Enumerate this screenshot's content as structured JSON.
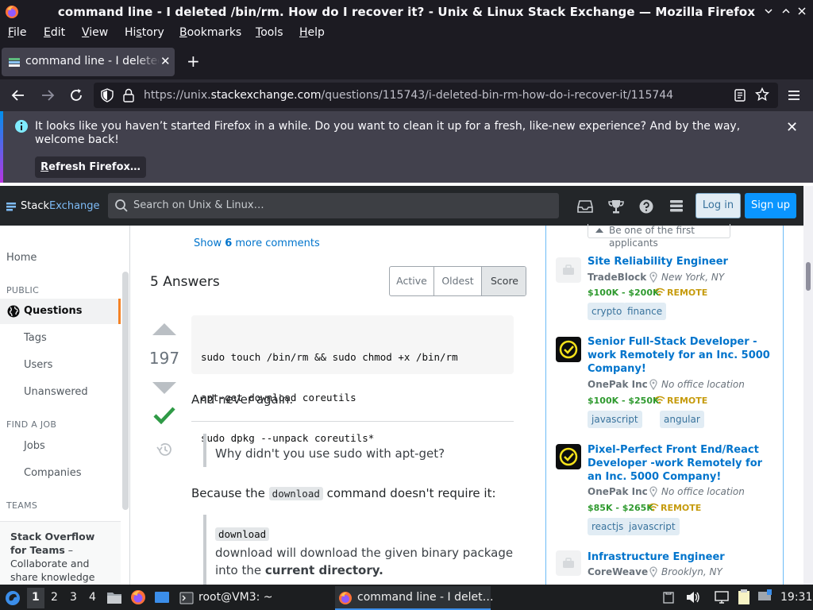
{
  "window": {
    "title": "command line - I deleted /bin/rm. How do I recover it? - Unix & Linux Stack Exchange — Mozilla Firefox"
  },
  "menu": {
    "items": [
      {
        "u": "F",
        "rest": "ile"
      },
      {
        "u": "E",
        "rest": "dit"
      },
      {
        "u": "V",
        "rest": "iew"
      },
      {
        "pre": "Hi",
        "u": "s",
        "rest": "tory"
      },
      {
        "u": "B",
        "rest": "ookmarks"
      },
      {
        "u": "T",
        "rest": "ools"
      },
      {
        "u": "H",
        "rest": "elp"
      }
    ]
  },
  "tab": {
    "label": "command line - I deleted /bin/rm. How do I recover it?"
  },
  "address": {
    "prefix": "https://unix.",
    "domain": "stackexchange.com",
    "path": "/questions/115743/i-deleted-bin-rm-how-do-i-recover-it/115744"
  },
  "notification": {
    "message": "It looks like you haven’t started Firefox in a while. Do you want to clean it up for a fresh, like-new experience? And by the way, welcome back!",
    "button_u": "R",
    "button_rest": "efresh Firefox…"
  },
  "se": {
    "logo_a": "Stack",
    "logo_b": "Exchange",
    "search_placeholder": "Search on Unix & Linux…",
    "login": "Log in",
    "signup": "Sign up"
  },
  "leftnav": {
    "home": "Home",
    "public": "PUBLIC",
    "questions": "Questions",
    "tags": "Tags",
    "users": "Users",
    "unanswered": "Unanswered",
    "find_job": "FIND A JOB",
    "jobs": "Jobs",
    "companies": "Companies",
    "teams": "TEAMS",
    "teams_bold": "Stack Overflow for Teams",
    "teams_rest": " – Collaborate and share knowledge with a private group."
  },
  "main": {
    "show_comments_pre": "Show ",
    "show_comments_count": "6",
    "show_comments_post": " more comments",
    "answers_heading": "5 Answers",
    "sort_tabs": [
      "Active",
      "Oldest",
      "Score"
    ],
    "sort_selected": "Score",
    "vote_count": "197",
    "code_lines": [
      "sudo touch /bin/rm && sudo chmod +x /bin/rm",
      "apt-get download coreutils",
      "sudo dpkg --unpack coreutils*"
    ],
    "never_again": "And never again.",
    "quote1": "Why didn't you use sudo with apt-get?",
    "because_pre": "Because the ",
    "because_code": "download",
    "because_post": " command doesn't require it:",
    "quote2_code": "download",
    "quote2_line1": "download will download the given binary package",
    "quote2_line2_pre": "into the ",
    "quote2_line2_bold": "current directory."
  },
  "jobs": {
    "first_applicants": "Be one of the first applicants",
    "list": [
      {
        "title": "Site Reliability Engineer",
        "company": "TradeBlock",
        "location": "New York, NY",
        "salary": "$100K - $200K",
        "remote": "REMOTE",
        "tags": [
          "crypto",
          "finance"
        ],
        "logo": "tradeblock-logo"
      },
      {
        "title": "Senior Full-Stack Developer - work Remotely for an Inc. 5000 Company!",
        "company": "OnePak Inc",
        "location": "No office location",
        "salary": "$100K - $250K",
        "remote": "REMOTE",
        "tags": [
          "javascript",
          "angular"
        ],
        "logo": "onepak-logo"
      },
      {
        "title": "Pixel-Perfect Front End/React Developer -work Remotely for an Inc. 5000 Company!",
        "company": "OnePak Inc",
        "location": "No office location",
        "salary": "$85K - $265K",
        "remote": "REMOTE",
        "tags": [
          "reactjs",
          "javascript"
        ],
        "logo": "onepak-logo"
      },
      {
        "title": "Infrastructure Engineer",
        "company": "CoreWeave",
        "location": "Brooklyn, NY",
        "logo": "coreweave-logo"
      }
    ]
  },
  "taskbar": {
    "workspaces": [
      "1",
      "2",
      "3",
      "4"
    ],
    "terminal": "root@VM3: ~",
    "firefox": "command line - I delet…",
    "clock": "19:31"
  },
  "colors": {
    "accent_blue": "#0074cc",
    "se_orange": "#f48225",
    "accepted_green": "#2f9a46",
    "salary_green": "#2f9a2f",
    "remote_gold": "#c69b0d"
  }
}
